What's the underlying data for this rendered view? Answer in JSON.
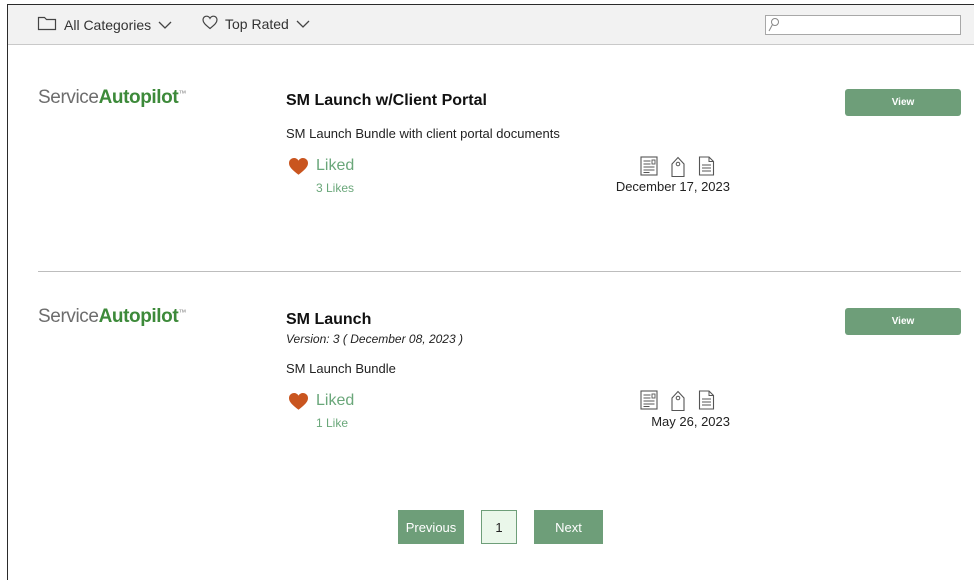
{
  "toolbar": {
    "categories_label": "All Categories",
    "sort_label": "Top Rated",
    "search_placeholder": "",
    "search_value": ""
  },
  "brand": {
    "logo_part1": "Service",
    "logo_part2": "Autopilot",
    "logo_tm": "™",
    "accent_color": "#6e9e79",
    "logo_color": "#3d8a3a",
    "heart_color": "#c9551f"
  },
  "items": [
    {
      "title": "SM Launch w/Client Portal",
      "version": "",
      "description": "SM Launch Bundle with client portal documents",
      "liked_label": "Liked",
      "likes_text": "3 Likes",
      "date": "December 17, 2023",
      "view_label": "View",
      "icons": [
        "form-icon",
        "tag-icon",
        "document-icon"
      ]
    },
    {
      "title": "SM Launch",
      "version": "Version: 3 ( December 08, 2023 )",
      "description": "SM Launch Bundle",
      "liked_label": "Liked",
      "likes_text": "1 Like",
      "date": "May 26, 2023",
      "view_label": "View",
      "icons": [
        "form-icon",
        "tag-icon",
        "document-icon"
      ]
    }
  ],
  "pagination": {
    "previous_label": "Previous",
    "current_page": "1",
    "next_label": "Next"
  }
}
